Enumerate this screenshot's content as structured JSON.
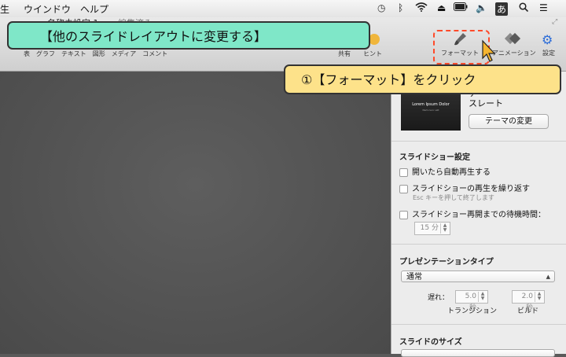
{
  "menubar": {
    "items": [
      "生",
      "ウインドウ",
      "ヘルプ"
    ],
    "status_icons": [
      "history-icon",
      "bluetooth-icon",
      "wifi-icon",
      "eject-icon",
      "battery-icon",
      "volume-icon",
      "input-method-icon",
      "search-icon",
      "list-icon"
    ],
    "input_method_label": "あ"
  },
  "window": {
    "title": "名称未設定 1",
    "edited": "編集済み",
    "toolbar": {
      "left_labels": "表　グラフ　テキスト　図形　メディア　コメント",
      "share": "共有",
      "tips": "ヒント",
      "format": "フォーマット",
      "animate": "アニメーション",
      "setup": "設定"
    }
  },
  "panel": {
    "thumb_title": "Lorem Ipsum Dolor",
    "thumb_sub": "Nam nunc elit",
    "theme_name_top": "テ",
    "theme_name": "スレート",
    "theme_change_button": "テーマの変更",
    "slideshow_section": "スライドショー設定",
    "autoplay": "開いたら自動再生する",
    "loop": "スライドショーの再生を繰り返す",
    "esc_hint": "Esc キーを押して終了します",
    "idle_restart": "スライドショー再開までの待機時間：",
    "idle_minutes": "15 分",
    "presentation_type_section": "プレゼンテーションタイプ",
    "presentation_type": "通常",
    "delay_label": "遅れ：",
    "transition_value": "5.0 秒",
    "build_value": "2.0 秒",
    "transition_label": "トランジション",
    "build_label": "ビルド",
    "slide_size_section": "スライドのサイズ"
  },
  "annotations": {
    "top": "【他のスライドレイアウトに変更する】",
    "right": "①【フォーマット】をクリック"
  },
  "colors": {
    "top_callout": "#7fe7c8",
    "right_callout": "#fde28a",
    "highlight": "#ff4a2a",
    "accent": "#2b6cd8"
  }
}
